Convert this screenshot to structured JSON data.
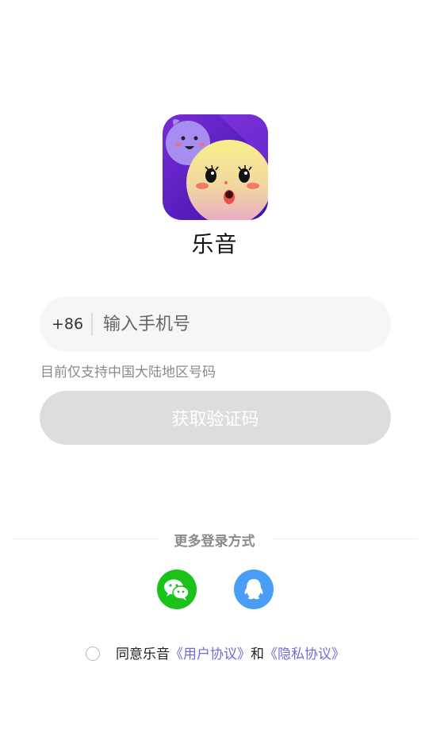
{
  "app": {
    "name": "乐音",
    "logo_icon": "app-logo-cartoon-faces"
  },
  "phone": {
    "country_code": "+86",
    "placeholder": "输入手机号",
    "value": "",
    "hint": "目前仅支持中国大陆地区号码"
  },
  "actions": {
    "get_code_label": "获取验证码"
  },
  "more_login": {
    "title": "更多登录方式",
    "methods": [
      {
        "name": "wechat",
        "icon": "wechat-icon",
        "color": "#1ac21a"
      },
      {
        "name": "qq",
        "icon": "qq-icon",
        "color": "#4a9df5"
      }
    ]
  },
  "agreement": {
    "checked": false,
    "prefix": "同意乐音",
    "user_agreement": "《用户协议》",
    "conjunction": "和",
    "privacy_policy": "《隐私协议》",
    "link_color": "#6f6bd6"
  }
}
